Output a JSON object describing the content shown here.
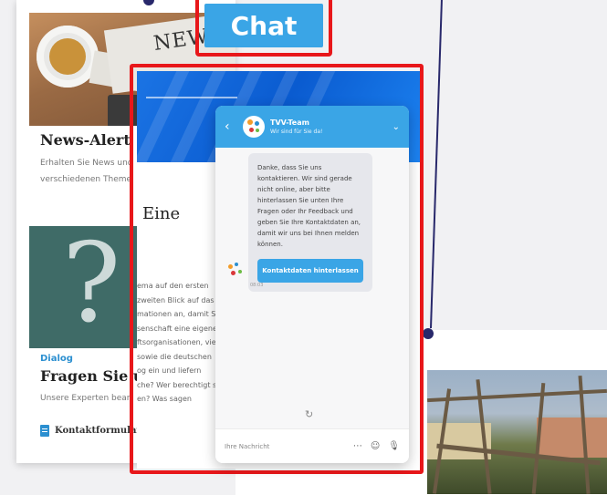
{
  "left_column": {
    "news": {
      "title": "News-Alert",
      "description_lines": [
        "Erhalten Sie News und",
        "verschiedenen Theme"
      ],
      "image_text": "NEWS"
    },
    "dialog": {
      "kicker": "Dialog",
      "title": "Fragen Sie u",
      "description": "Unsere Experten bean"
    },
    "kontakt_link": "Kontaktformular"
  },
  "middle_page": {
    "heading": "Eine",
    "article_lines": [
      "ema auf den ersten",
      "zweiten Blick auf das",
      "mationen an, damit S",
      "senschaft eine eigene",
      "ftsorganisationen, viel",
      "sowie die deutschen",
      "og ein und liefern",
      "che? Wer berechtigt sie",
      "en? Was sagen"
    ]
  },
  "annotation": {
    "label": "Chat",
    "color": "#e8171a",
    "badge_color": "#3aa5e6"
  },
  "chat_widget": {
    "team_name": "TVV-Team",
    "subtitle": "Wir sind für Sie da!",
    "message": "Danke, dass Sie uns kontaktieren. Wir sind gerade nicht online, aber bitte hinterlassen Sie unten Ihre Fragen oder Ihr Feedback und geben Sie Ihre Kontaktdaten an, damit wir uns bei Ihnen melden können.",
    "cta_label": "Kontaktdaten hinterlassen",
    "timestamp": "08:03",
    "input_placeholder": "Ihre Nachricht",
    "icons": [
      "back-icon",
      "chevron-down-icon",
      "refresh-icon",
      "more-icon",
      "emoji-icon",
      "microphone-icon"
    ],
    "accent_color": "#3aa5e6"
  }
}
